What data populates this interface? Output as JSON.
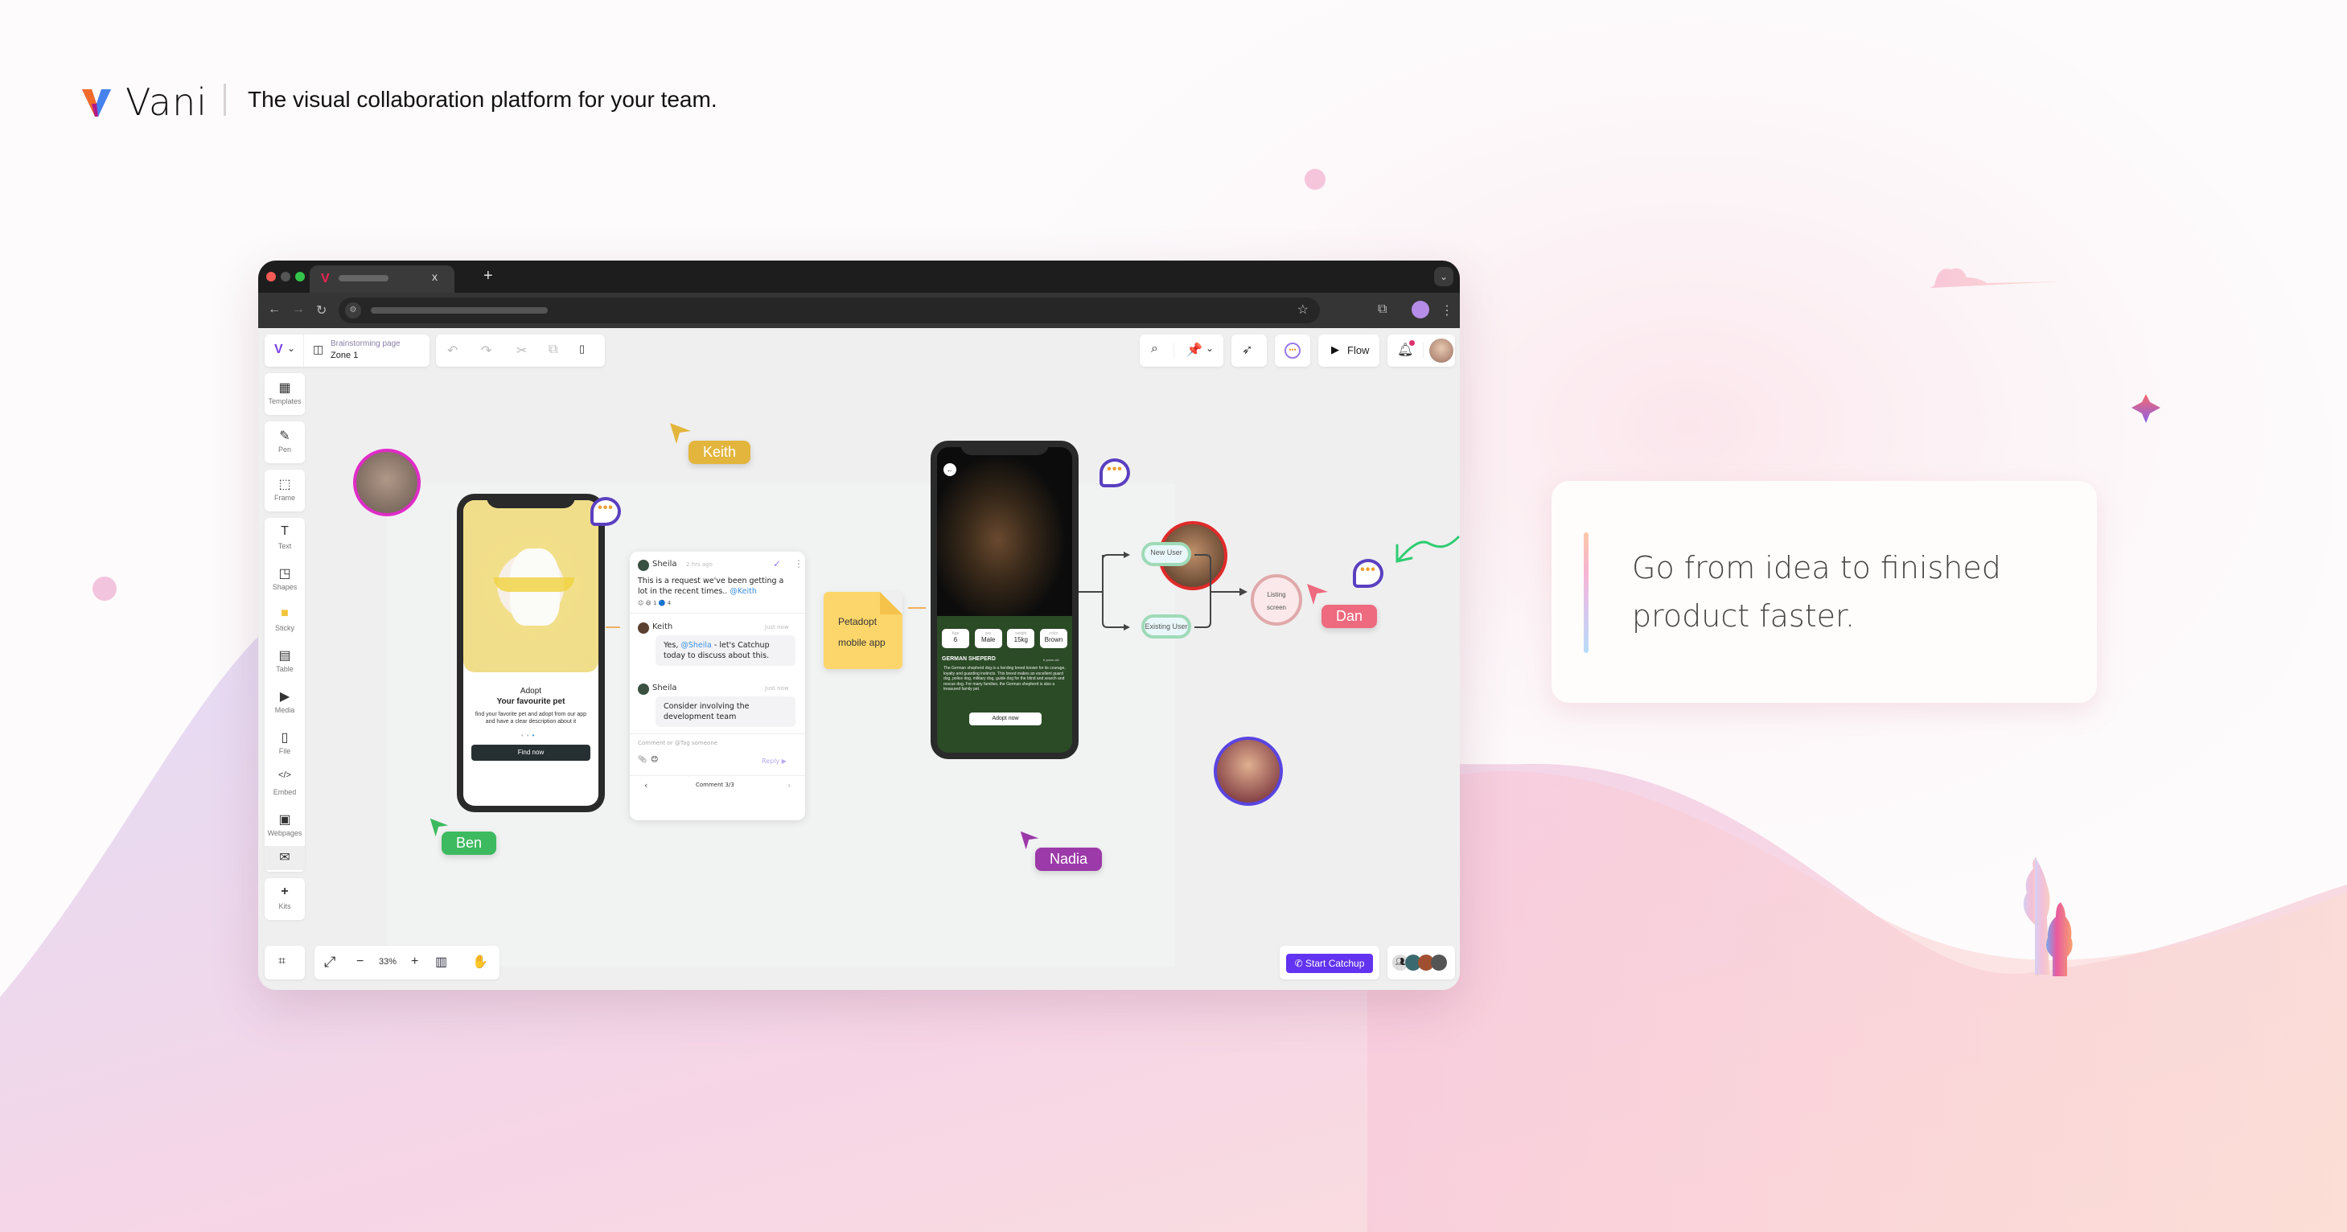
{
  "brand": {
    "name": "Vani",
    "tagline": "The visual collaboration platform for your team."
  },
  "browser": {
    "tab_close": "x",
    "new_tab": "+",
    "nav_back": "←",
    "nav_forward": "→",
    "nav_reload": "↻",
    "bookmark_icon": "☆",
    "extensions_icon": "⧉",
    "menu_icon": "⋮",
    "tab_dropdown": "⌄"
  },
  "app_toolbar": {
    "board_title": "Brainstorming page",
    "zone": "Zone 1",
    "flow_label": "Flow",
    "undo": "↶",
    "redo": "↷",
    "cut": "✂",
    "copy": "⧉",
    "paste": "📋",
    "search": "🔍",
    "chevron": "⌄"
  },
  "sidebar": {
    "groups": [
      [
        {
          "icon": "▦",
          "label": "Templates"
        }
      ],
      [
        {
          "icon": "✎",
          "label": "Pen"
        }
      ],
      [
        {
          "icon": "⬚",
          "label": "Frame"
        }
      ],
      [
        {
          "icon": "T",
          "label": "Text"
        },
        {
          "icon": "◳",
          "label": "Shapes"
        },
        {
          "icon": "■",
          "label": "Sticky"
        },
        {
          "icon": "▤",
          "label": "Table"
        },
        {
          "icon": "▶",
          "label": "Media"
        },
        {
          "icon": "▯",
          "label": "File"
        },
        {
          "icon": "</>",
          "label": "Embed"
        },
        {
          "icon": "▣",
          "label": "Webpages"
        },
        {
          "icon": "✉",
          "label": ""
        }
      ],
      [
        {
          "icon": "+",
          "label": "Kits"
        }
      ]
    ]
  },
  "bottom_bar": {
    "fit_icon": "⌗",
    "expand_icon": "⤢",
    "zoom_out": "−",
    "zoom_level": "33%",
    "zoom_in": "+",
    "map_icon": "▥",
    "hand_icon": "✋",
    "start_catchup": "Start Catchup",
    "phone_icon": "✆"
  },
  "canvas": {
    "cursors": [
      {
        "name": "Keith",
        "color": "#e3b53c"
      },
      {
        "name": "Dan",
        "color": "#ee6a7e"
      },
      {
        "name": "Ben",
        "color": "#3dba5f"
      },
      {
        "name": "Nadia",
        "color": "#9b3aa8"
      }
    ],
    "phone1": {
      "title": "Adopt",
      "subtitle": "Your favourite pet",
      "description": "find your favorite pet and adopt from our app and have a clear description about it",
      "cta": "Find now"
    },
    "comment_thread": {
      "items": [
        {
          "author": "Sheila",
          "time": "2 hrs ago",
          "text": "This is a request we've been getting a lot in the recent times..",
          "mention": "@Keith",
          "reactions": [
            "😃 1",
            "🔵 4"
          ]
        },
        {
          "author": "Keith",
          "time": "Just now",
          "text_pre": "Yes, ",
          "mention": "@Sheila",
          "text_post": " - let's Catchup today to discuss about this."
        },
        {
          "author": "Sheila",
          "time": "Just now",
          "text": "Consider involving the development team"
        }
      ],
      "input_placeholder": "Comment or @Tag someone",
      "reply_label": "Reply ▶",
      "pager": "Comment 3/3",
      "prev": "‹",
      "next": "›"
    },
    "sticky": {
      "line1": "Petadopt",
      "line2": "mobile app"
    },
    "phone2": {
      "stats": [
        {
          "label": "Age",
          "value": "6"
        },
        {
          "label": "sex",
          "value": "Male"
        },
        {
          "label": "weight",
          "value": "15kg"
        },
        {
          "label": "color",
          "value": "Brown"
        }
      ],
      "breed": "GERMAN SHEPERD",
      "age_text": "6 years old",
      "description": "The German shepherd dog is a herding breed known for its courage, loyalty and guarding instincts. This breed makes an excellent guard dog, police dog, military dog, guide dog for the blind and search and rescue dog. For many families, the German shepherd is also a treasured family pet.",
      "cta": "Adopt now"
    },
    "flow": {
      "new_user": "New User",
      "existing_user": "Existing User",
      "listing": "Listing screen"
    }
  },
  "feature_card": {
    "text": "Go from idea to finished product faster."
  }
}
